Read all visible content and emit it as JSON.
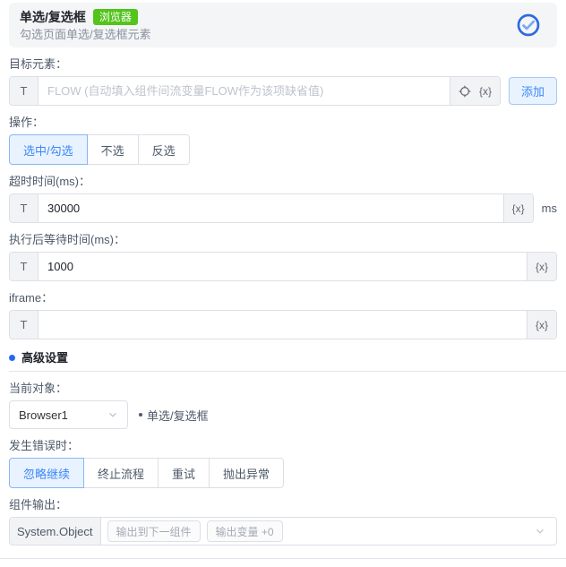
{
  "header": {
    "title": "单选/复选框",
    "badge": "浏览器",
    "subtitle": "勾选页面单选/复选框元素"
  },
  "fields": {
    "target": {
      "label": "目标元素：",
      "prefix": "T",
      "placeholder": "FLOW (自动填入组件间流变量FLOW作为该项缺省值)",
      "variable_token": "{x}",
      "add_button": "添加"
    },
    "action": {
      "label": "操作：",
      "options": [
        "选中/勾选",
        "不选",
        "反选"
      ],
      "selected": "选中/勾选"
    },
    "timeout": {
      "label": "超时时间(ms)：",
      "prefix": "T",
      "value": "30000",
      "variable_token": "{x}",
      "unit": "ms"
    },
    "wait_after": {
      "label": "执行后等待时间(ms)：",
      "prefix": "T",
      "value": "1000",
      "variable_token": "{x}"
    },
    "iframe": {
      "label": "iframe：",
      "prefix": "T",
      "value": "",
      "variable_token": "{x}"
    }
  },
  "advanced": {
    "heading": "高级设置",
    "current_object": {
      "label": "当前对象：",
      "value": "Browser1",
      "note": "单选/复选框"
    },
    "on_error": {
      "label": "发生错误时：",
      "options": [
        "忽略继续",
        "终止流程",
        "重试",
        "抛出异常"
      ],
      "selected": "忽略继续"
    },
    "output": {
      "label": "组件输出：",
      "type": "System.Object",
      "chips": [
        "输出到下一组件",
        "输出变量 +0"
      ]
    }
  },
  "colors": {
    "accent_blue": "#3d87f5",
    "badge_green": "#52c41a",
    "active_bg": "#e9f3ff"
  }
}
